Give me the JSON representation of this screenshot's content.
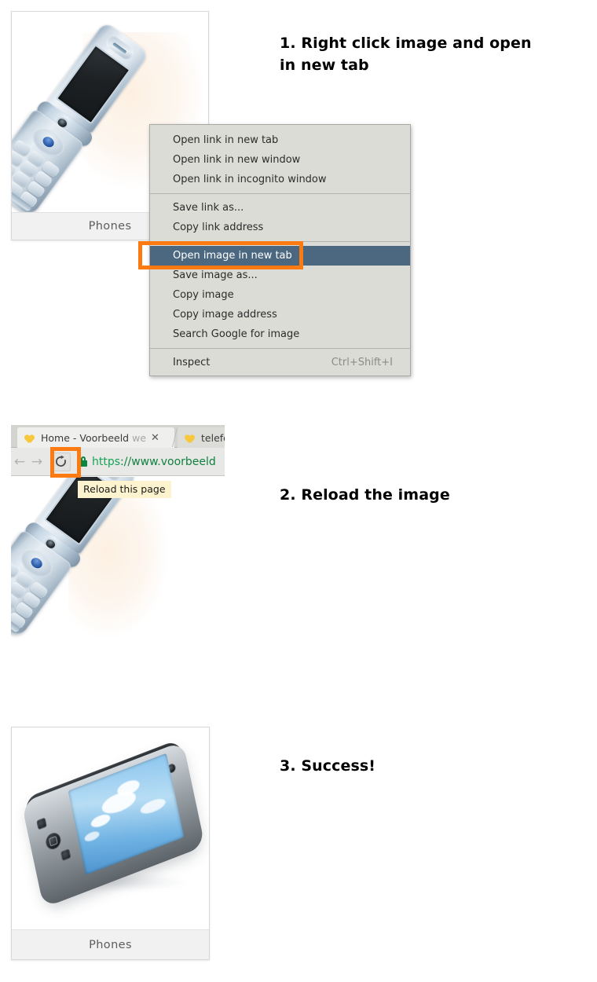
{
  "steps": [
    {
      "id": "step1",
      "title": "1. Right click image and open in new tab"
    },
    {
      "id": "step2",
      "title": "2. Reload the image"
    },
    {
      "id": "step3",
      "title": "3. Success!"
    }
  ],
  "cards": [
    {
      "caption": "Phones",
      "image_alt": "silver flip phone"
    },
    {
      "caption": "Phones",
      "image_alt": "black smartphone with blue sky wallpaper"
    }
  ],
  "context_menu": {
    "groups": [
      {
        "items": [
          {
            "label": "Open link in new tab",
            "shortcut": "",
            "selected": false
          },
          {
            "label": "Open link in new window",
            "shortcut": "",
            "selected": false
          },
          {
            "label": "Open link in incognito window",
            "shortcut": "",
            "selected": false
          }
        ]
      },
      {
        "items": [
          {
            "label": "Save link as...",
            "shortcut": "",
            "selected": false
          },
          {
            "label": "Copy link address",
            "shortcut": "",
            "selected": false
          }
        ]
      },
      {
        "items": [
          {
            "label": "Open image in new tab",
            "shortcut": "",
            "selected": true
          },
          {
            "label": "Save image as...",
            "shortcut": "",
            "selected": false
          },
          {
            "label": "Copy image",
            "shortcut": "",
            "selected": false
          },
          {
            "label": "Copy image address",
            "shortcut": "",
            "selected": false
          },
          {
            "label": "Search Google for image",
            "shortcut": "",
            "selected": false
          }
        ]
      },
      {
        "items": [
          {
            "label": "Inspect",
            "shortcut": "Ctrl+Shift+I",
            "selected": false
          }
        ]
      }
    ],
    "selected_item_label": "Open image in new tab",
    "selection_color": "#4c6880",
    "background_color": "#dcdcd7"
  },
  "highlights": {
    "color": "#fc7a12",
    "targets": [
      "Open image in new tab",
      "Reload this page"
    ]
  },
  "browser": {
    "tabs": [
      {
        "title": "Home - Voorbeeld",
        "title_faded": "we",
        "favicon": "heart-icon",
        "active": true,
        "close": "✕"
      },
      {
        "title": "telefoo",
        "title_faded": "",
        "favicon": "heart-icon",
        "active": false,
        "close": ""
      }
    ],
    "toolbar": {
      "back_icon": "←",
      "forward_icon": "→",
      "reload_icon": "reload-icon",
      "reload_tooltip": "Reload this page",
      "url_scheme": "https",
      "url_separator": "://",
      "url_host": "www.voorbeeld",
      "lock_icon": "lock-icon",
      "secure_color": "#10803f"
    }
  }
}
